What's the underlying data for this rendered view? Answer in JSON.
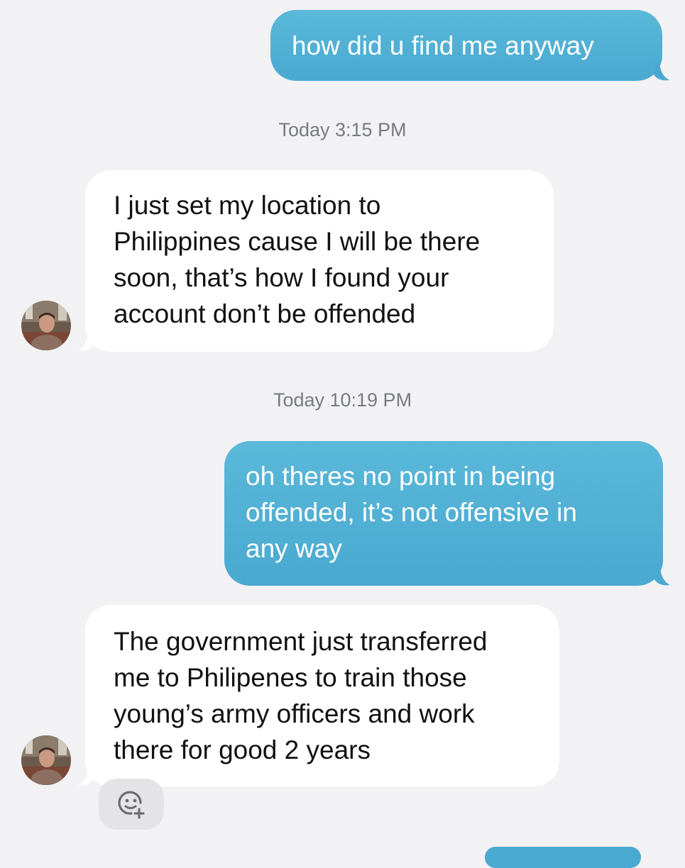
{
  "messages": [
    {
      "type": "sent",
      "text": "how did u find me anyway"
    },
    {
      "type": "timestamp",
      "text": "Today 3:15 PM"
    },
    {
      "type": "received",
      "lines": [
        "I just set my location to",
        "Philippines cause I will be there",
        "soon, that’s how I found your",
        "account don’t be offended"
      ]
    },
    {
      "type": "timestamp",
      "text": "Today 10:19 PM"
    },
    {
      "type": "sent",
      "lines": [
        "oh theres no point in being",
        "offended, it’s not offensive in",
        "any way"
      ]
    },
    {
      "type": "received",
      "lines": [
        "The government just transferred",
        "me to Philipenes to train those",
        "young’s army officers and work",
        "there for good 2 years"
      ]
    }
  ],
  "reaction_button": {
    "icon": "add-reaction-icon"
  },
  "colors": {
    "sent_bubble": "#4aa9d0",
    "received_bubble": "#ffffff",
    "background": "#f2f2f4",
    "timestamp": "#777a80"
  }
}
